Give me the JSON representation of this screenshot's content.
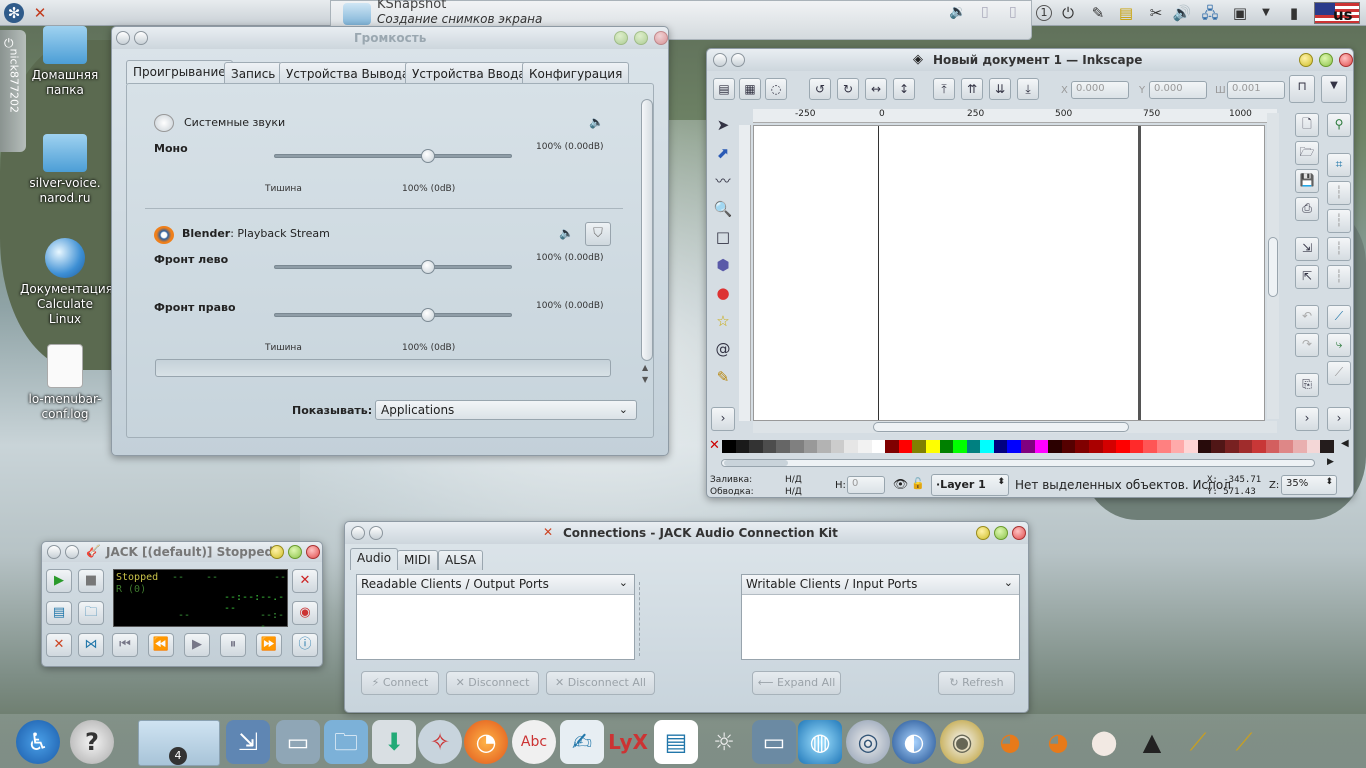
{
  "topbar": {
    "left_icons": [
      "kde-logo-icon",
      "jack-icon"
    ],
    "right_icons": [
      "number-icon",
      "power-icon",
      "tools-icon",
      "note-icon",
      "scissors-icon",
      "volume-icon",
      "network-icon",
      "window-icon",
      "chevron-down-icon",
      "battery-icon"
    ],
    "number_label": "1",
    "kbd_layout": "us"
  },
  "ksnapshot": {
    "title": "KSnapshot",
    "subtitle": "Создание снимков экрана"
  },
  "side_label": "nick877202",
  "desktop": {
    "icons": [
      {
        "label1": "Домашняя",
        "label2": "папка",
        "icon": "home-folder-icon"
      },
      {
        "label1": "silver-voice.",
        "label2": "narod.ru",
        "icon": "folder-icon"
      },
      {
        "label1": "Документация",
        "label2": "Calculate Linux",
        "icon": "globe-icon"
      },
      {
        "label1": "lo-menubar-",
        "label2": "conf.log",
        "icon": "text-file-icon"
      }
    ]
  },
  "mixer": {
    "title": "Громкость",
    "tabs": [
      "Проигрывание",
      "Запись",
      "Устройства Вывода",
      "Устройства Ввода",
      "Конфигурация"
    ],
    "streams": [
      {
        "app": "Системные звуки",
        "channels": [
          {
            "name": "Моно",
            "value": "100% (0.00dB)",
            "level": 1.0
          }
        ],
        "scale_min": "Тишина",
        "scale_mid": "100% (0dB)"
      },
      {
        "app_bold": "Blender",
        "app_rest": ": Playback Stream",
        "channels": [
          {
            "name": "Фронт лево",
            "value": "100% (0.00dB)",
            "level": 1.0
          },
          {
            "name": "Фронт право",
            "value": "100% (0.00dB)",
            "level": 1.0
          }
        ],
        "scale_min": "Тишина",
        "scale_mid": "100% (0dB)"
      }
    ],
    "show_label": "Показывать:",
    "show_value": "Applications"
  },
  "inkscape": {
    "title": "Новый документ 1 — Inkscape",
    "x_label": "X",
    "x_val": "0.000",
    "y_label": "Y",
    "y_val": "0.000",
    "w_label": "Ш",
    "w_val": "0.001",
    "ruler": [
      "-250",
      "0",
      "250",
      "500",
      "750",
      "1000"
    ],
    "fill_label": "Заливка:",
    "fill_val": "Н/Д",
    "stroke_label": "Обводка:",
    "stroke_val": "Н/Д",
    "h_label": "H:",
    "h_val": "0",
    "layer": "·Layer 1",
    "status": "Нет выделенных объектов. Испол",
    "coord_x": "X: -345.71",
    "coord_y": "Y:  571.43",
    "zoom_label": "Z:",
    "zoom_val": "35%",
    "palette": [
      "#000000",
      "#1a1a1a",
      "#333333",
      "#4d4d4d",
      "#666666",
      "#808080",
      "#999999",
      "#b3b3b3",
      "#cccccc",
      "#e6e6e6",
      "#f2f2f2",
      "#ffffff",
      "#800000",
      "#ff0000",
      "#808000",
      "#ffff00",
      "#008000",
      "#00ff00",
      "#008080",
      "#00ffff",
      "#000080",
      "#0000ff",
      "#800080",
      "#ff00ff",
      "#2b0000",
      "#550000",
      "#800000",
      "#aa0000",
      "#d40000",
      "#ff0000",
      "#ff2a2a",
      "#ff5555",
      "#ff8080",
      "#ffaaaa",
      "#ffd5d5",
      "#280b0b",
      "#501616",
      "#782121",
      "#a02c2c",
      "#c83737",
      "#d35f5f",
      "#de8787",
      "#e9afaf",
      "#f4d7d7",
      "#241c1c"
    ]
  },
  "jack": {
    "title": "JACK [(default)] Stopped.",
    "status": "Stopped",
    "dashes1": "--",
    "dashes2": "--",
    "dashes3": "--",
    "sub": "R (0)",
    "time": "--:--:--.---",
    "d4": "--",
    "d5": "--:--"
  },
  "connections": {
    "title": "Connections - JACK Audio Connection Kit",
    "tabs": [
      "Audio",
      "MIDI",
      "ALSA"
    ],
    "left_header": "Readable Clients / Output Ports",
    "right_header": "Writable Clients / Input Ports",
    "buttons": [
      "Connect",
      "Disconnect",
      "Disconnect All",
      "Expand All",
      "Refresh"
    ]
  },
  "taskbar": {
    "badge": "4"
  }
}
